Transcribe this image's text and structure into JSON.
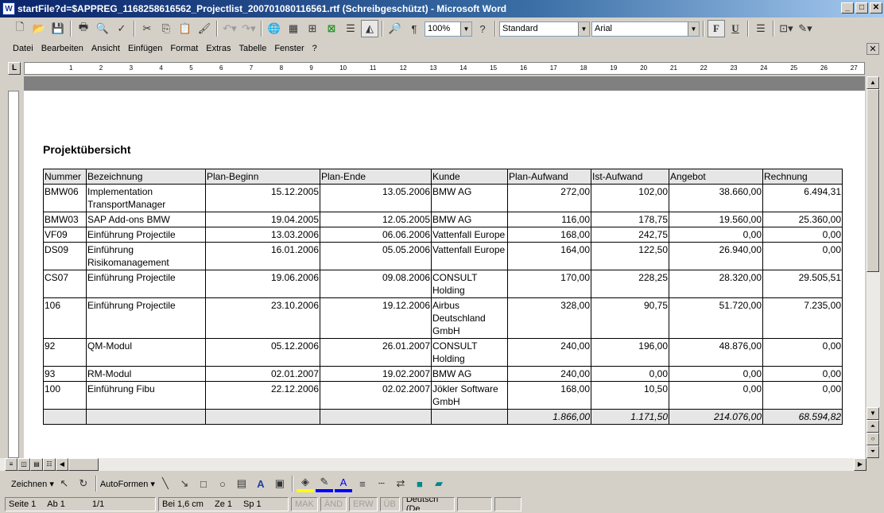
{
  "window": {
    "title": "startFile?d=$APPREG_1168258616562_Projectlist_200701080116561.rtf (Schreibgeschützt) - Microsoft Word",
    "app_icon": "W"
  },
  "toolbar": {
    "zoom": "100%",
    "style": "Standard",
    "font": "Arial",
    "bold": "F",
    "underline": "U"
  },
  "menu": [
    "Datei",
    "Bearbeiten",
    "Ansicht",
    "Einfügen",
    "Format",
    "Extras",
    "Tabelle",
    "Fenster",
    "?"
  ],
  "ruler": [
    "1",
    "2",
    "3",
    "4",
    "5",
    "6",
    "7",
    "8",
    "9",
    "10",
    "11",
    "12",
    "13",
    "14",
    "15",
    "16",
    "17",
    "18",
    "19",
    "20",
    "21",
    "22",
    "23",
    "24",
    "25",
    "26",
    "27"
  ],
  "document": {
    "heading": "Projektübersicht",
    "columns": [
      "Nummer",
      "Bezeichnung",
      "Plan-Beginn",
      "Plan-Ende",
      "Kunde",
      "Plan-Aufwand",
      "Ist-Aufwand",
      "Angebot",
      "Rechnung"
    ],
    "rows": [
      [
        "BMW06",
        "Implementation TransportManager",
        "15.12.2005",
        "13.05.2006",
        "BMW AG",
        "272,00",
        "102,00",
        "38.660,00",
        "6.494,31"
      ],
      [
        "BMW03",
        "SAP Add-ons BMW",
        "19.04.2005",
        "12.05.2005",
        "BMW AG",
        "116,00",
        "178,75",
        "19.560,00",
        "25.360,00"
      ],
      [
        "VF09",
        "Einführung Projectile",
        "13.03.2006",
        "06.06.2006",
        "Vattenfall Europe",
        "168,00",
        "242,75",
        "0,00",
        "0,00"
      ],
      [
        "DS09",
        "Einführung Risikomanagement",
        "16.01.2006",
        "05.05.2006",
        "Vattenfall Europe",
        "164,00",
        "122,50",
        "26.940,00",
        "0,00"
      ],
      [
        "CS07",
        "Einführung Projectile",
        "19.06.2006",
        "09.08.2006",
        "CONSULT Holding",
        "170,00",
        "228,25",
        "28.320,00",
        "29.505,51"
      ],
      [
        "106",
        "Einführung Projectile",
        "23.10.2006",
        "19.12.2006",
        "Airbus Deutschland GmbH",
        "328,00",
        "90,75",
        "51.720,00",
        "7.235,00"
      ],
      [
        "92",
        "QM-Modul",
        "05.12.2006",
        "26.01.2007",
        "CONSULT Holding",
        "240,00",
        "196,00",
        "48.876,00",
        "0,00"
      ],
      [
        "93",
        "RM-Modul",
        "02.01.2007",
        "19.02.2007",
        "BMW AG",
        "240,00",
        "0,00",
        "0,00",
        "0,00"
      ],
      [
        "100",
        "Einführung Fibu",
        "22.12.2006",
        "02.02.2007",
        "Jökler Software GmbH",
        "168,00",
        "10,50",
        "0,00",
        "0,00"
      ]
    ],
    "totals": [
      "",
      "",
      "",
      "",
      "",
      "1.866,00",
      "1.171,50",
      "214.076,00",
      "68.594,82"
    ]
  },
  "drawing": {
    "draw": "Zeichnen",
    "autoshapes": "AutoFormen"
  },
  "status": {
    "page": "Seite  1",
    "section": "Ab  1",
    "pages": "1/1",
    "at": "Bei  1,6 cm",
    "line": "Ze  1",
    "col": "Sp  1",
    "rec": "MAK",
    "trk": "ÄND",
    "ext": "ERW",
    "ovr": "ÜB",
    "lang": "Deutsch (De"
  }
}
